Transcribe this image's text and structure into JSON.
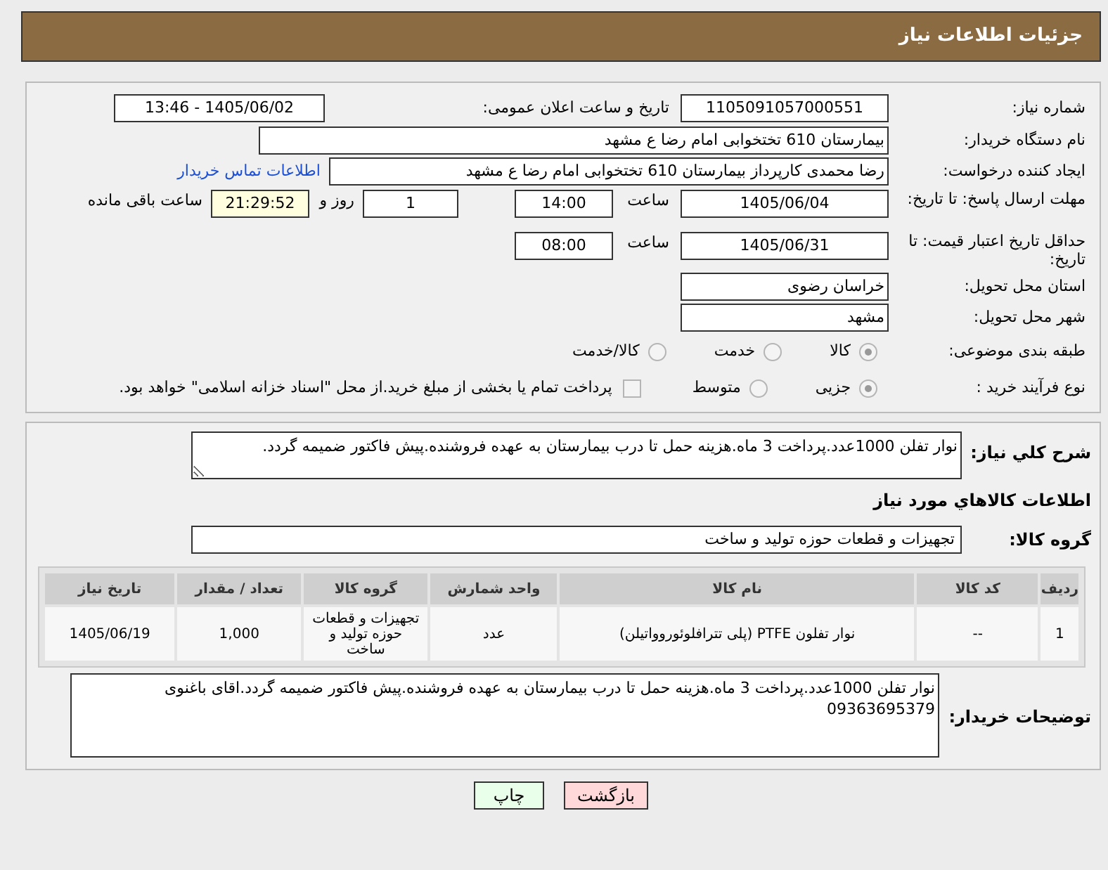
{
  "header": {
    "title": "جزئیات اطلاعات نیاز"
  },
  "need_number": {
    "label": "شماره نیاز:",
    "value": "1105091057000551"
  },
  "announce": {
    "label": "تاریخ و ساعت اعلان عمومی:",
    "value": "1405/06/02 - 13:46"
  },
  "buyer": {
    "label": "نام دستگاه خریدار:",
    "value": "بیمارستان 610 تختخوابی امام رضا ع  مشهد"
  },
  "creator": {
    "label": "ایجاد کننده درخواست:",
    "value": "رضا محمدی کارپرداز بیمارستان 610 تختخوابی امام رضا ع  مشهد",
    "link": "اطلاعات تماس خریدار"
  },
  "deadline": {
    "label": "مهلت ارسال پاسخ: تا تاریخ:",
    "date": "1405/06/04",
    "time_label": "ساعت",
    "time": "14:00",
    "days": "1",
    "days_label": "روز و",
    "remaining": "21:29:52",
    "remaining_label": "ساعت باقی مانده"
  },
  "validity": {
    "label": "حداقل تاریخ اعتبار قیمت: تا تاریخ:",
    "date": "1405/06/31",
    "time_label": "ساعت",
    "time": "08:00"
  },
  "province": {
    "label": "استان محل تحویل:",
    "value": "خراسان رضوی"
  },
  "city": {
    "label": "شهر محل تحویل:",
    "value": "مشهد"
  },
  "category": {
    "label": "طبقه بندی موضوعی:",
    "options": [
      {
        "label": "کالا",
        "selected": true
      },
      {
        "label": "خدمت",
        "selected": false
      },
      {
        "label": "کالا/خدمت",
        "selected": false
      }
    ]
  },
  "process": {
    "label": "نوع فرآیند خرید :",
    "options": [
      {
        "label": "جزیی",
        "selected": true
      },
      {
        "label": "متوسط",
        "selected": false
      }
    ],
    "treasury": {
      "label": "پرداخت تمام یا بخشی از مبلغ خرید.از محل \"اسناد خزانه اسلامی\" خواهد بود.",
      "checked": false
    }
  },
  "description": {
    "label": "شرح کلي نیاز:",
    "value": "نوار تفلن 1000عدد.پرداخت 3 ماه.هزینه حمل تا درب بیمارستان به عهده فروشنده.پیش فاکتور ضمیمه گردد."
  },
  "items_heading": "اطلاعات کالاهاي مورد نیاز",
  "goods_group": {
    "label": "گروه کالا:",
    "value": "تجهیزات و قطعات حوزه تولید و ساخت"
  },
  "table": {
    "columns": [
      "ردیف",
      "کد کالا",
      "نام کالا",
      "واحد شمارش",
      "گروه کالا",
      "تعداد / مقدار",
      "تاریخ نیاز"
    ],
    "rows": [
      [
        "1",
        "--",
        "نوار تفلون PTFE (پلی تترافلوئوروواتیلن)",
        "عدد",
        "تجهیزات و قطعات حوزه تولید و ساخت",
        "1,000",
        "1405/06/19"
      ]
    ]
  },
  "buyer_notes": {
    "label": "توضیحات خریدار:",
    "value": "نوار تفلن 1000عدد.پرداخت 3 ماه.هزینه حمل تا درب بیمارستان به عهده فروشنده.پیش فاکتور ضمیمه گردد.اقای باغنوی 09363695379"
  },
  "buttons": [
    {
      "label": "بازگشت",
      "kind": "back"
    },
    {
      "label": "چاپ",
      "kind": "print"
    }
  ]
}
